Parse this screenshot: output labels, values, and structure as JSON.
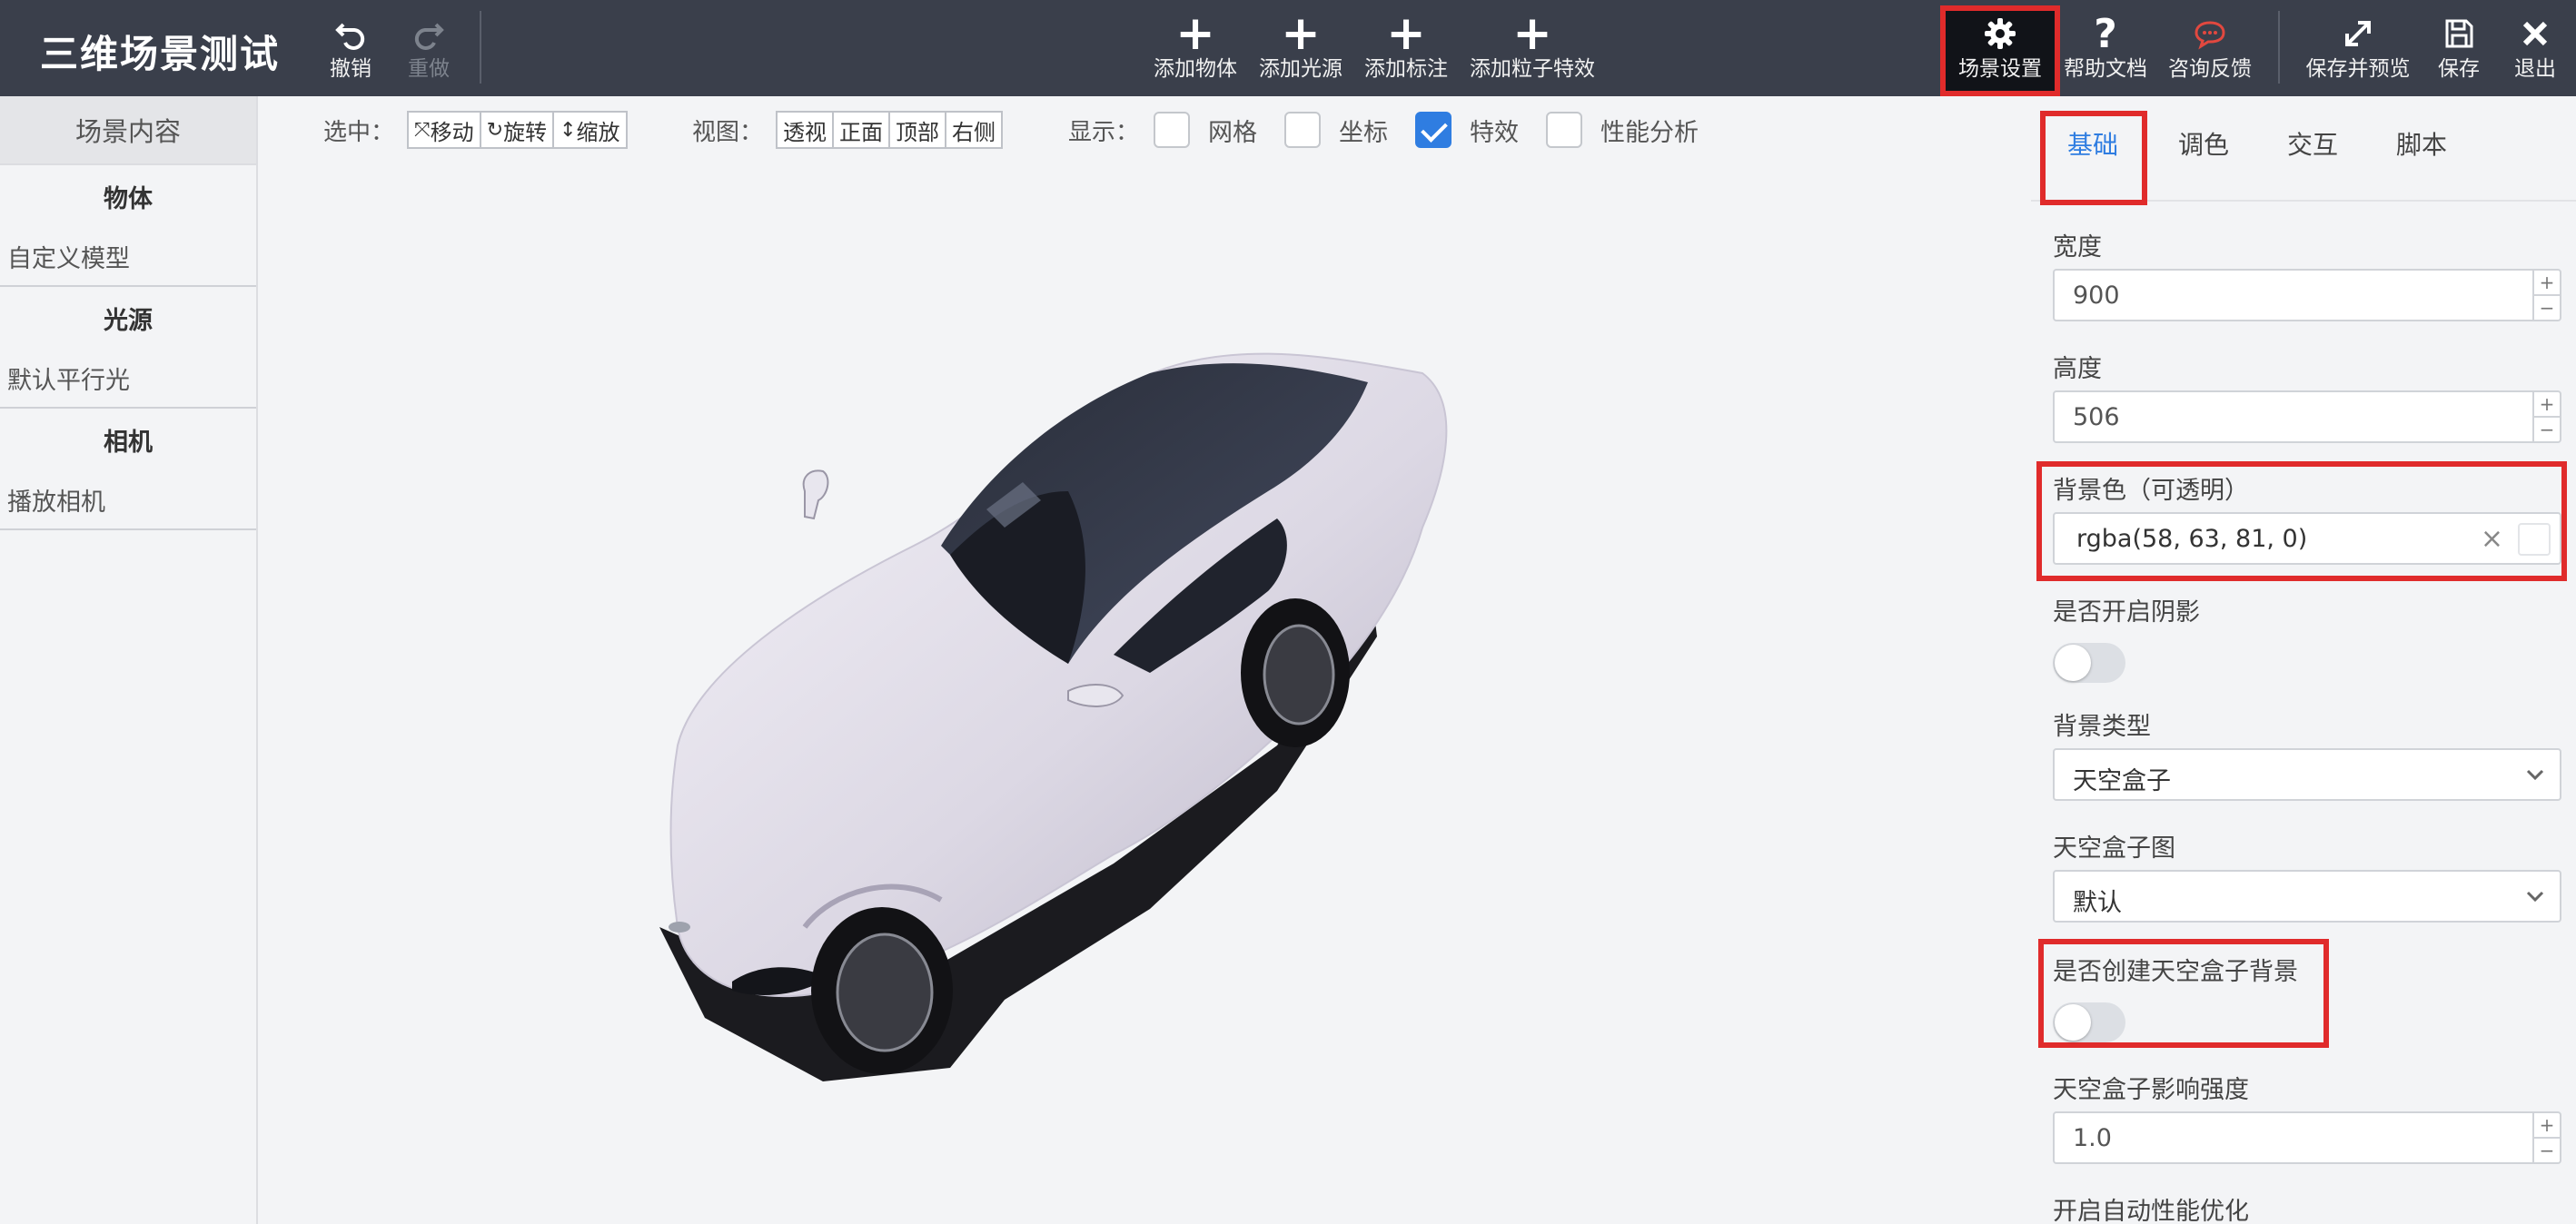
{
  "app": {
    "title": "三维场景测试"
  },
  "toolbar": {
    "undo": "撤销",
    "redo": "重做",
    "add_object": "添加物体",
    "add_light": "添加光源",
    "add_label": "添加标注",
    "add_particle": "添加粒子特效",
    "scene_settings": "场景设置",
    "help_docs": "帮助文档",
    "feedback": "咨询反馈",
    "save_preview": "保存并预览",
    "save": "保存",
    "exit": "退出"
  },
  "sidebar": {
    "header": "场景内容",
    "groups": [
      {
        "title": "物体",
        "items": [
          "自定义模型"
        ]
      },
      {
        "title": "光源",
        "items": [
          "默认平行光"
        ]
      },
      {
        "title": "相机",
        "items": [
          "播放相机"
        ]
      }
    ]
  },
  "canvas_toolbar": {
    "select_label": "选中：",
    "select_buttons": [
      "移动",
      "旋转",
      "缩放"
    ],
    "view_label": "视图：",
    "view_buttons": [
      "透视",
      "正面",
      "顶部",
      "右侧"
    ],
    "display_label": "显示：",
    "display_options": [
      {
        "label": "网格",
        "checked": false
      },
      {
        "label": "坐标",
        "checked": false
      },
      {
        "label": "特效",
        "checked": true
      },
      {
        "label": "性能分析",
        "checked": false
      }
    ]
  },
  "panel": {
    "tabs": [
      "基础",
      "调色",
      "交互",
      "脚本"
    ],
    "active_tab": "基础",
    "width_label": "宽度",
    "width_value": "900",
    "height_label": "高度",
    "height_value": "506",
    "bg_color_label": "背景色（可透明）",
    "bg_color_value": "rgba(58, 63, 81, 0)",
    "shadow_label": "是否开启阴影",
    "bg_type_label": "背景类型",
    "bg_type_value": "天空盒子",
    "skybox_img_label": "天空盒子图",
    "skybox_img_value": "默认",
    "create_skybox_label": "是否创建天空盒子背景",
    "skybox_intensity_label": "天空盒子影响强度",
    "skybox_intensity_value": "1.0",
    "auto_perf_label": "开启自动性能优化"
  },
  "colors": {
    "topbar": "#3a3f4b",
    "accent": "#2f7de1",
    "highlight": "#e02b2b"
  }
}
